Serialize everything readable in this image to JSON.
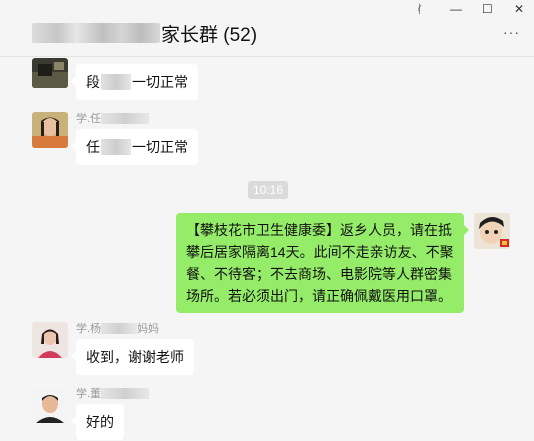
{
  "window": {
    "pin_icon": "pin-icon",
    "minimize_icon": "minimize-icon",
    "maximize_icon": "maximize-icon",
    "close_icon": "close-icon",
    "pin_glyph": "ᚰ",
    "minimize_glyph": "—",
    "maximize_glyph": "☐",
    "close_glyph": "✕"
  },
  "header": {
    "title_suffix": "家长群 (52)",
    "more_glyph": "···"
  },
  "messages": [
    {
      "sender_prefix": "",
      "text_prefix": "段",
      "text_suffix": "一切正常"
    },
    {
      "sender_prefix": "学.任",
      "text_prefix": "任",
      "text_suffix": "一切正常"
    },
    {
      "timestamp": "10:16"
    },
    {
      "own": true,
      "text": "【攀枝花市卫生健康委】返乡人员，请在抵攀后居家隔离14天。此间不走亲访友、不聚餐、不待客；不去商场、电影院等人群密集场所。若必须出门，请正确佩戴医用口罩。"
    },
    {
      "sender_prefix": "学.杨",
      "sender_suffix": "妈妈",
      "text": "收到，谢谢老师"
    },
    {
      "sender_prefix": "学.董",
      "text": "好的"
    }
  ],
  "colors": {
    "background": "#f5f5f5",
    "bubble_other": "#ffffff",
    "bubble_own": "#95ec69",
    "timestamp_bg": "#dadada"
  }
}
